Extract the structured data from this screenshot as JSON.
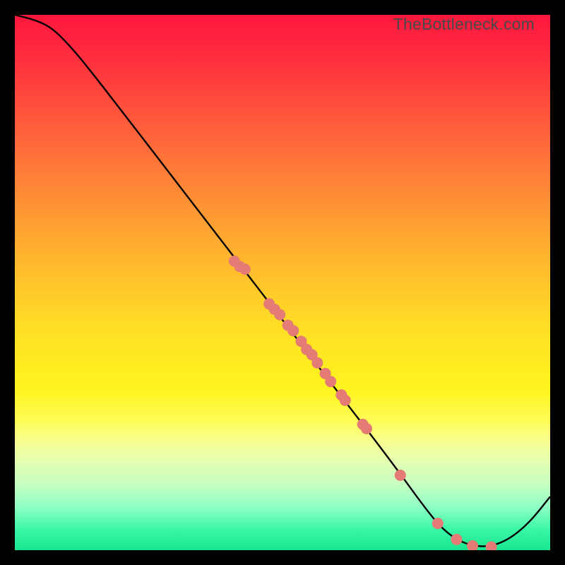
{
  "watermark": "TheBottleneck.com",
  "colors": {
    "dot_fill": "#e47b75",
    "curve_stroke": "#000000",
    "frame": "#000000"
  },
  "chart_data": {
    "type": "line",
    "title": "",
    "xlabel": "",
    "ylabel": "",
    "xlim": [
      0,
      100
    ],
    "ylim": [
      0,
      100
    ],
    "notes": "Background gradient encodes bottleneck severity: red=high, green=low. Curve is a performance curve; dots mark observed configurations.",
    "curve": [
      {
        "x": 0,
        "y": 100
      },
      {
        "x": 4,
        "y": 99
      },
      {
        "x": 7,
        "y": 97.5
      },
      {
        "x": 10,
        "y": 94.5
      },
      {
        "x": 13,
        "y": 91
      },
      {
        "x": 20,
        "y": 82
      },
      {
        "x": 30,
        "y": 69
      },
      {
        "x": 40,
        "y": 56
      },
      {
        "x": 50,
        "y": 43
      },
      {
        "x": 60,
        "y": 30
      },
      {
        "x": 70,
        "y": 17
      },
      {
        "x": 78,
        "y": 6
      },
      {
        "x": 81,
        "y": 3
      },
      {
        "x": 84,
        "y": 1.2
      },
      {
        "x": 88,
        "y": 0.5
      },
      {
        "x": 92,
        "y": 1.8
      },
      {
        "x": 96,
        "y": 5
      },
      {
        "x": 100,
        "y": 10
      }
    ],
    "series": [
      {
        "name": "observations",
        "points": [
          {
            "x": 41,
            "y": 54
          },
          {
            "x": 42,
            "y": 53
          },
          {
            "x": 43,
            "y": 52.5
          },
          {
            "x": 47.5,
            "y": 46
          },
          {
            "x": 48.5,
            "y": 45
          },
          {
            "x": 49.5,
            "y": 44
          },
          {
            "x": 51,
            "y": 42
          },
          {
            "x": 52,
            "y": 41
          },
          {
            "x": 53.5,
            "y": 39
          },
          {
            "x": 54.5,
            "y": 37.5
          },
          {
            "x": 55.5,
            "y": 36.5
          },
          {
            "x": 56.5,
            "y": 35
          },
          {
            "x": 58,
            "y": 33
          },
          {
            "x": 59,
            "y": 31.5
          },
          {
            "x": 61,
            "y": 29
          },
          {
            "x": 61.7,
            "y": 28
          },
          {
            "x": 65,
            "y": 23.5
          },
          {
            "x": 65.7,
            "y": 22.7
          },
          {
            "x": 72,
            "y": 14
          },
          {
            "x": 79,
            "y": 5
          },
          {
            "x": 82.5,
            "y": 2
          },
          {
            "x": 85.5,
            "y": 0.8
          },
          {
            "x": 89,
            "y": 0.6
          }
        ]
      }
    ]
  }
}
